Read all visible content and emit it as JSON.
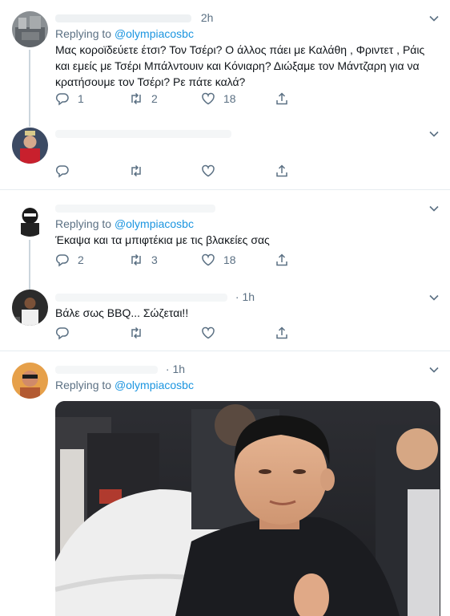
{
  "tweets": [
    {
      "time": "2h",
      "replying_prefix": "Replying to",
      "replying_handle": "@olympiacosbc",
      "text": "Μας κοροϊδεύετε έτσι? Τον Τσέρι? Ο άλλος πάει με Καλάθη , Φριντετ , Ράις και εμείς με Τσέρι Μπάλντουιν και Κόνιαρη? Διώξαμε τον Μάντζαρη για να κρατήσουμε τον Τσέρι? Ρε πάτε καλά?",
      "reply_count": "1",
      "retweet_count": "2",
      "like_count": "18"
    },
    {
      "reply_count": "",
      "retweet_count": "",
      "like_count": ""
    },
    {
      "replying_prefix": "Replying to",
      "replying_handle": "@olympiacosbc",
      "text": "Έκαψα και τα μπιφτέκια με τις βλακείες σας",
      "reply_count": "2",
      "retweet_count": "3",
      "like_count": "18"
    },
    {
      "time": "· 1h",
      "text": "Βάλε σως BBQ... Σώζεται!!",
      "reply_count": "",
      "retweet_count": "",
      "like_count": ""
    },
    {
      "time": "· 1h",
      "replying_prefix": "Replying to",
      "replying_handle": "@olympiacosbc"
    }
  ],
  "icons": {
    "reply": "reply-icon",
    "retweet": "retweet-icon",
    "like": "like-icon",
    "share": "share-icon",
    "more": "chevron-down-icon"
  },
  "colors": {
    "link": "#1b95e0",
    "muted": "#5b7083",
    "divider": "#e6ecf0",
    "thread_line": "#ccd6dd"
  }
}
